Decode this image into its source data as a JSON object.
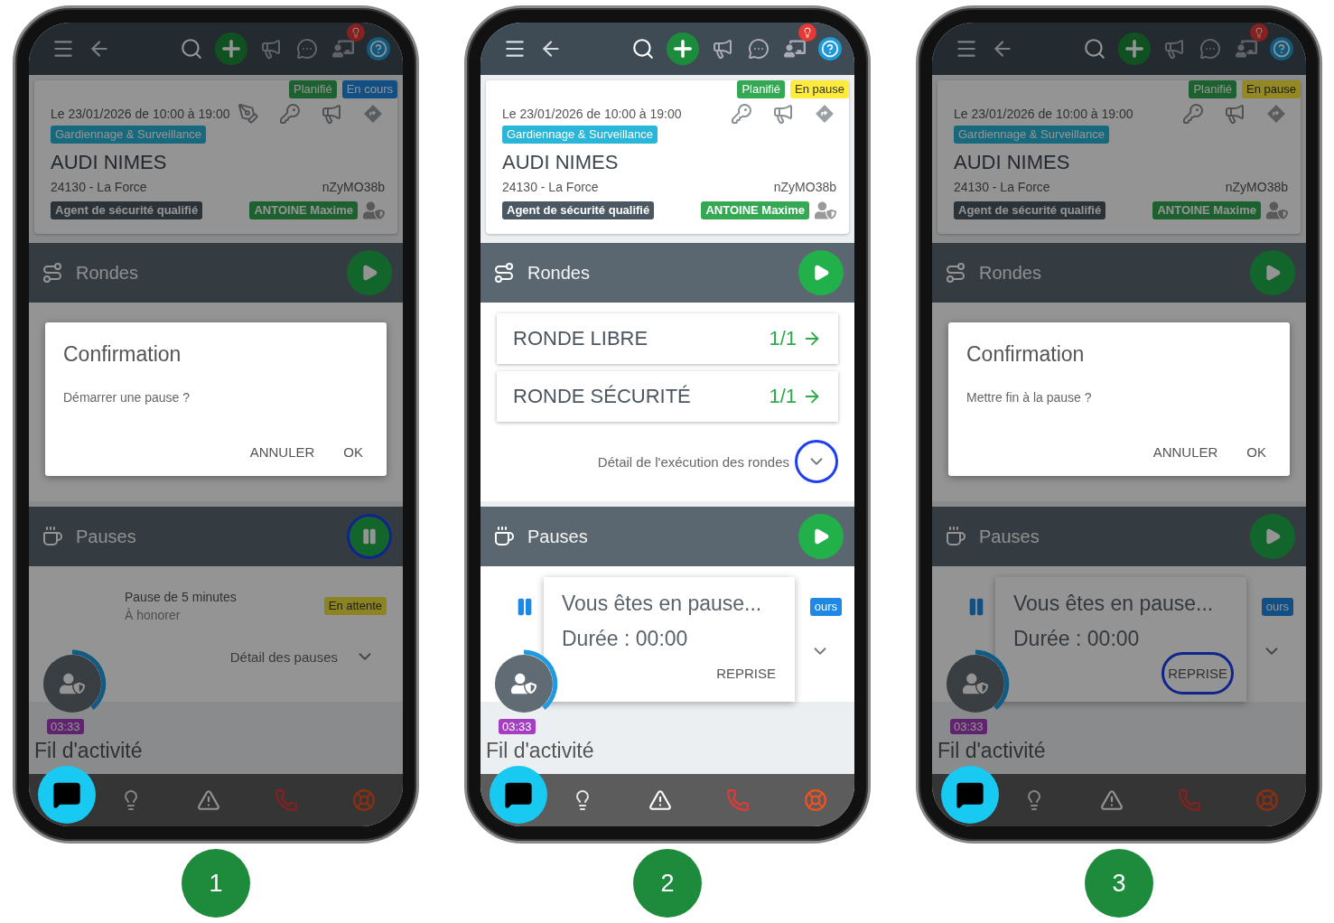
{
  "phones": [
    {
      "step": "1",
      "dimmed": true,
      "statuses": [
        {
          "label": "Planifié",
          "kind": "planned"
        },
        {
          "label": "En cours",
          "kind": "ongoing"
        }
      ],
      "date": "Le 23/01/2026 de 10:00 à 19:00",
      "can_sign": true,
      "category": "Gardiennage & Surveillance",
      "site": "AUDI NIMES",
      "city": "24130 - La Force",
      "code": "nZyMO38b",
      "qualification": "Agent de sécurité qualifié",
      "agent": "ANTOINE Maxime",
      "rounds": {
        "title": "Rondes",
        "tapped": false,
        "body": {
          "kind": "dialog",
          "title": "Confirmation",
          "message": "Démarrer une pause ?",
          "buttons": [
            "ANNULER",
            "OK"
          ]
        }
      },
      "pauses": {
        "title": "Pauses",
        "running": true,
        "tapped": true,
        "body": {
          "kind": "summary",
          "name": "Pause de 5 minutes",
          "note": "À honorer",
          "badge": "En attente",
          "detail": "Détail des pauses"
        }
      },
      "timer": "03:33",
      "feed": "Fil d'activité"
    },
    {
      "step": "2",
      "dimmed": false,
      "statuses": [
        {
          "label": "Planifié",
          "kind": "planned"
        },
        {
          "label": "En pause",
          "kind": "paused"
        }
      ],
      "date": "Le 23/01/2026 de 10:00 à 19:00",
      "can_sign": false,
      "category": "Gardiennage & Surveillance",
      "site": "AUDI NIMES",
      "city": "24130 - La Force",
      "code": "nZyMO38b",
      "qualification": "Agent de sécurité qualifié",
      "agent": "ANTOINE Maxime",
      "rounds": {
        "title": "Rondes",
        "tapped": false,
        "body": {
          "kind": "list",
          "items": [
            {
              "name": "RONDE LIBRE",
              "count": "1/1"
            },
            {
              "name": "RONDE SÉCURITÉ",
              "count": "1/1"
            }
          ],
          "detail": "Détail de l'exécution des rondes",
          "tapped": true
        }
      },
      "pauses": {
        "title": "Pauses",
        "running": false,
        "tapped": false,
        "body": {
          "kind": "popup",
          "badge": "ours",
          "title": "Vous êtes en pause...",
          "duration": "Durée : 00:00",
          "action": "REPRISE",
          "tapped": false
        }
      },
      "timer": "03:33",
      "feed": "Fil d'activité"
    },
    {
      "step": "3",
      "dimmed": true,
      "statuses": [
        {
          "label": "Planifié",
          "kind": "planned"
        },
        {
          "label": "En pause",
          "kind": "paused"
        }
      ],
      "date": "Le 23/01/2026 de 10:00 à 19:00",
      "can_sign": false,
      "category": "Gardiennage & Surveillance",
      "site": "AUDI NIMES",
      "city": "24130 - La Force",
      "code": "nZyMO38b",
      "qualification": "Agent de sécurité qualifié",
      "agent": "ANTOINE Maxime",
      "rounds": {
        "title": "Rondes",
        "tapped": false,
        "body": {
          "kind": "dialog",
          "title": "Confirmation",
          "message": "Mettre fin à la pause ?",
          "buttons": [
            "ANNULER",
            "OK"
          ]
        }
      },
      "pauses": {
        "title": "Pauses",
        "running": false,
        "tapped": false,
        "body": {
          "kind": "popup",
          "badge": "ours",
          "title": "Vous êtes en pause...",
          "duration": "Durée : 00:00",
          "action": "REPRISE",
          "tapped": true
        }
      },
      "timer": "03:33",
      "feed": "Fil d'activité"
    }
  ]
}
